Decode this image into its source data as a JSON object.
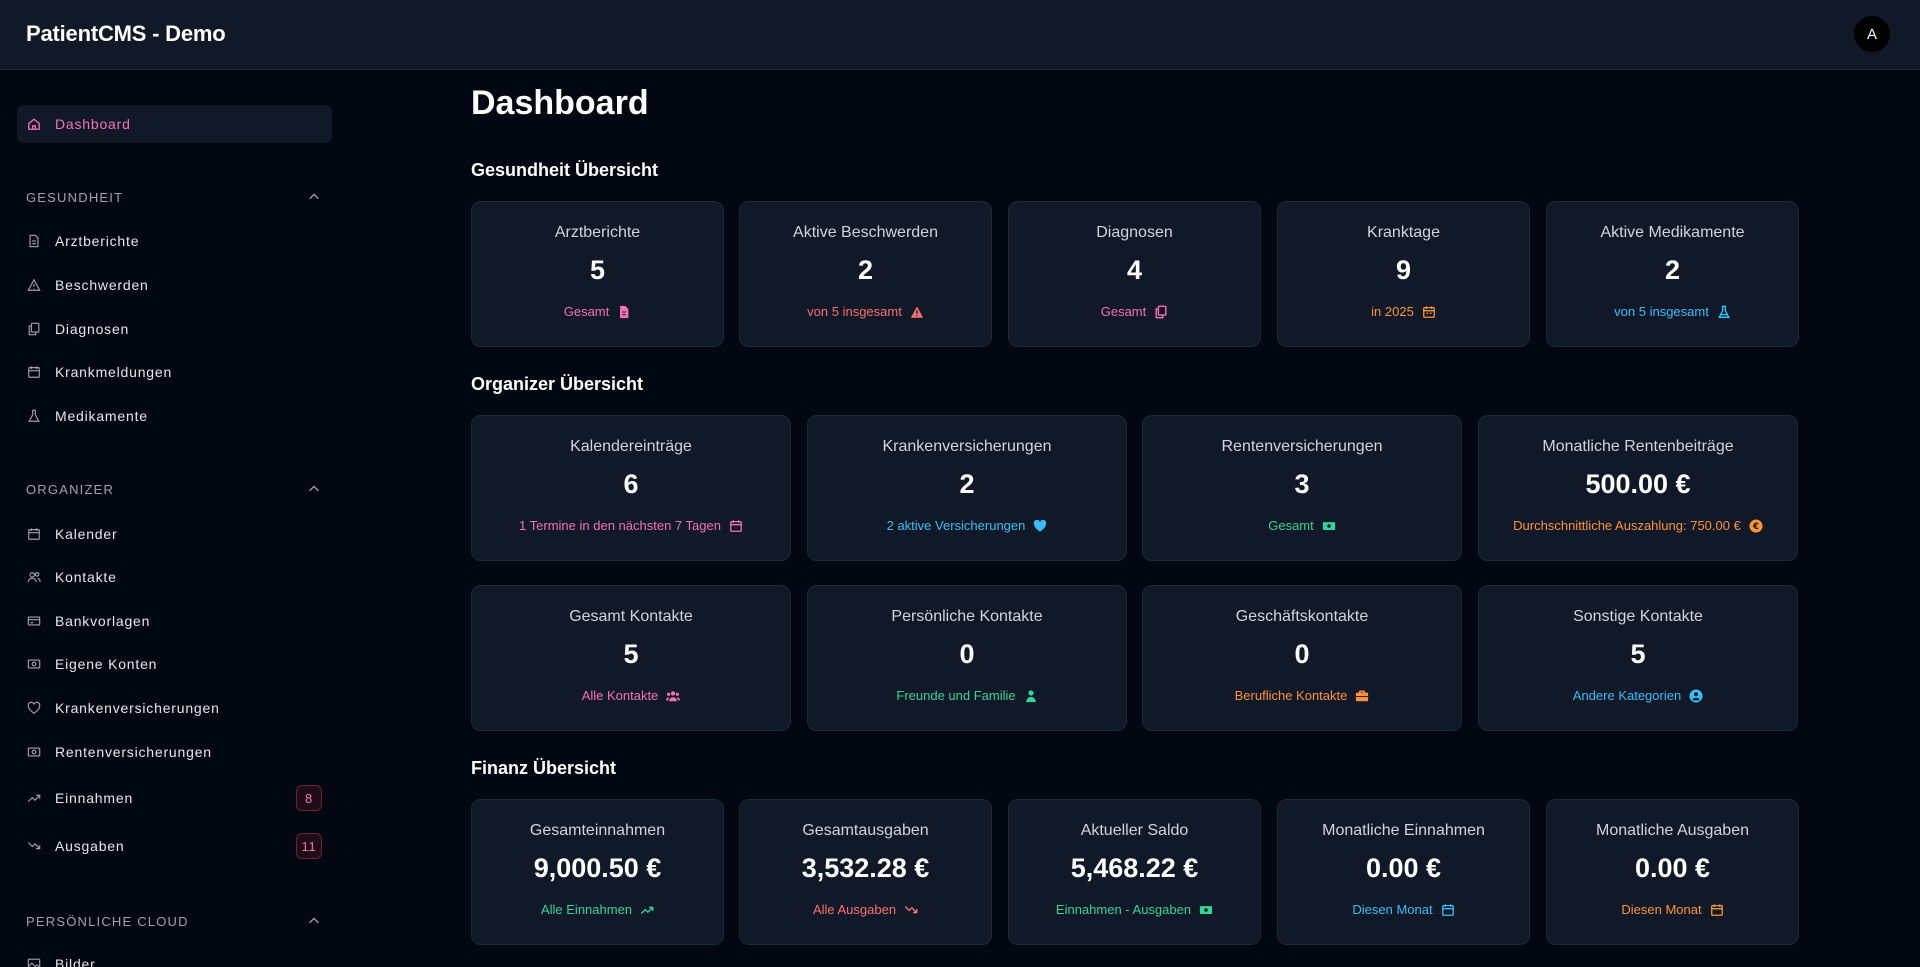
{
  "app": {
    "title": "PatientCMS - Demo",
    "avatar_initial": "A"
  },
  "sidebar": {
    "dashboard": "Dashboard",
    "sections": {
      "gesundheit": {
        "title": "GESUNDHEIT",
        "items": [
          "Arztberichte",
          "Beschwerden",
          "Diagnosen",
          "Krankmeldungen",
          "Medikamente"
        ]
      },
      "organizer": {
        "title": "ORGANIZER",
        "items": [
          "Kalender",
          "Kontakte",
          "Bankvorlagen",
          "Eigene Konten",
          "Krankenversicherungen",
          "Rentenversicherungen",
          "Einnahmen",
          "Ausgaben"
        ]
      },
      "cloud": {
        "title": "PERSÖNLICHE CLOUD",
        "items": [
          "Bilder"
        ]
      }
    },
    "badges": {
      "einnahmen": "8",
      "ausgaben": "11"
    }
  },
  "main": {
    "title": "Dashboard",
    "health": {
      "title": "Gesundheit Übersicht",
      "cards": [
        {
          "label": "Arztberichte",
          "value": "5",
          "sub": "Gesamt",
          "icon": "document-icon"
        },
        {
          "label": "Aktive Beschwerden",
          "value": "2",
          "sub": "von 5 insgesamt",
          "icon": "warning-icon"
        },
        {
          "label": "Diagnosen",
          "value": "4",
          "sub": "Gesamt",
          "icon": "copy-icon"
        },
        {
          "label": "Kranktage",
          "value": "9",
          "sub": "in 2025",
          "icon": "calendar-icon"
        },
        {
          "label": "Aktive Medikamente",
          "value": "2",
          "sub": "von 5 insgesamt",
          "icon": "flask-icon"
        }
      ]
    },
    "organizer": {
      "title": "Organizer Übersicht",
      "cards_row1": [
        {
          "label": "Kalendereinträge",
          "value": "6",
          "sub": "1 Termine in den nächsten 7 Tagen",
          "icon": "calendar-icon"
        },
        {
          "label": "Krankenversicherungen",
          "value": "2",
          "sub": "2 aktive Versicherungen",
          "icon": "heart-icon"
        },
        {
          "label": "Rentenversicherungen",
          "value": "3",
          "sub": "Gesamt",
          "icon": "money-icon"
        },
        {
          "label": "Monatliche Rentenbeiträge",
          "value": "500.00 €",
          "sub": "Durchschnittliche Auszahlung: 750.00 €",
          "icon": "euro-circle-icon"
        }
      ],
      "cards_row2": [
        {
          "label": "Gesamt Kontakte",
          "value": "5",
          "sub": "Alle Kontakte",
          "icon": "users-icon"
        },
        {
          "label": "Persönliche Kontakte",
          "value": "0",
          "sub": "Freunde und Familie",
          "icon": "person-icon"
        },
        {
          "label": "Geschäftskontakte",
          "value": "0",
          "sub": "Berufliche Kontakte",
          "icon": "briefcase-icon"
        },
        {
          "label": "Sonstige Kontakte",
          "value": "5",
          "sub": "Andere Kategorien",
          "icon": "user-circle-icon"
        }
      ]
    },
    "finance": {
      "title": "Finanz Übersicht",
      "cards": [
        {
          "label": "Gesamteinnahmen",
          "value": "9,000.50 €",
          "sub": "Alle Einnahmen",
          "icon": "trend-up-icon"
        },
        {
          "label": "Gesamtausgaben",
          "value": "3,532.28 €",
          "sub": "Alle Ausgaben",
          "icon": "trend-down-icon"
        },
        {
          "label": "Aktueller Saldo",
          "value": "5,468.22 €",
          "sub": "Einnahmen - Ausgaben",
          "icon": "money-icon"
        },
        {
          "label": "Monatliche Einnahmen",
          "value": "0.00 €",
          "sub": "Diesen Monat",
          "icon": "calendar-icon"
        },
        {
          "label": "Monatliche Ausgaben",
          "value": "0.00 €",
          "sub": "Diesen Monat",
          "icon": "calendar-icon"
        }
      ]
    }
  },
  "colors": {
    "background": "#030712",
    "card": "#111827",
    "pink": "#f472b6",
    "red": "#f87171",
    "orange": "#fb923c",
    "blue": "#38bdf8",
    "green": "#34d399"
  }
}
